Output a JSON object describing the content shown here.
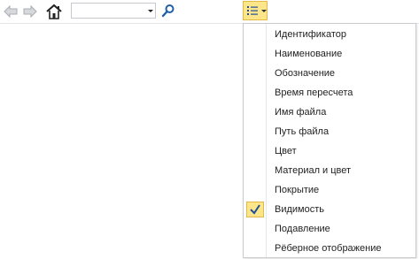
{
  "toolbar": {
    "back_icon": "arrow-left-icon",
    "forward_icon": "arrow-right-icon",
    "home_icon": "home-icon",
    "combo_value": "",
    "search_icon": "magnifier-icon",
    "list_button_icon": "list-icon",
    "list_button_color": "#fde68a"
  },
  "menu": {
    "items": [
      {
        "label": "Идентификатор",
        "checked": false
      },
      {
        "label": "Наименование",
        "checked": false
      },
      {
        "label": "Обозначение",
        "checked": false
      },
      {
        "label": "Время пересчета",
        "checked": false
      },
      {
        "label": "Имя файла",
        "checked": false
      },
      {
        "label": "Путь файла",
        "checked": false
      },
      {
        "label": "Цвет",
        "checked": false
      },
      {
        "label": "Материал и цвет",
        "checked": false
      },
      {
        "label": "Покрытие",
        "checked": false
      },
      {
        "label": "Видимость",
        "checked": true
      },
      {
        "label": "Подавление",
        "checked": false
      },
      {
        "label": "Рёберное отображение",
        "checked": false
      }
    ]
  }
}
